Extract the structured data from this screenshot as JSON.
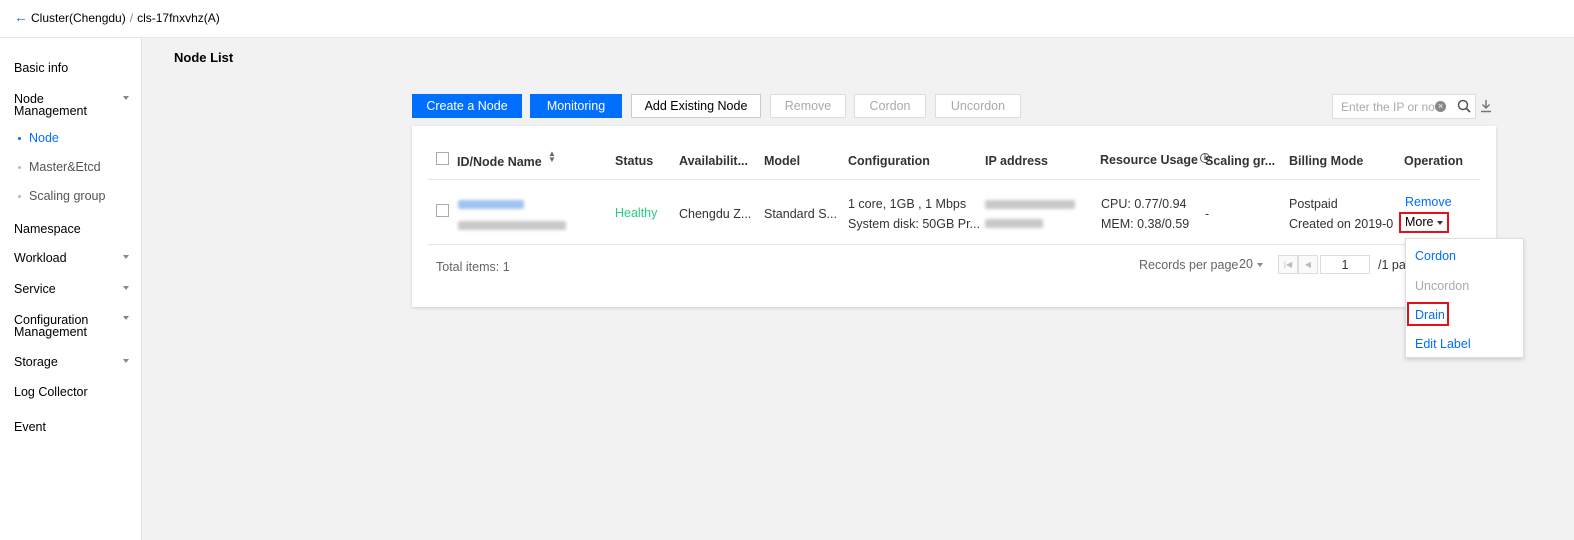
{
  "header": {
    "back_icon": "arrow-left-icon",
    "cluster": "Cluster(Chengdu)",
    "separator": "/",
    "cluster_id": "cls-17fnxvhz(A)"
  },
  "sidebar": {
    "basic_info": "Basic info",
    "node_mgmt_1": "Node",
    "node_mgmt_2": "Management",
    "node": "Node",
    "master": "Master&Etcd",
    "scaling": "Scaling group",
    "namespace": "Namespace",
    "workload": "Workload",
    "service": "Service",
    "config_1": "Configuration",
    "config_2": "Management",
    "storage": "Storage",
    "log": "Log Collector",
    "event": "Event"
  },
  "page": {
    "title": "Node List"
  },
  "toolbar": {
    "create": "Create a Node",
    "monitoring": "Monitoring",
    "add_existing": "Add Existing Node",
    "remove": "Remove",
    "cordon": "Cordon",
    "uncordon": "Uncordon",
    "search_placeholder": "Enter the IP or no",
    "accent": "#006eff"
  },
  "table": {
    "headers": {
      "id": "ID/Node Name",
      "status": "Status",
      "avail": "Availabilit...",
      "model": "Model",
      "config": "Configuration",
      "ip": "IP address",
      "usage": "Resource Usage",
      "scaling": "Scaling gr...",
      "billing": "Billing Mode",
      "operation": "Operation"
    },
    "rows": [
      {
        "status": "Healthy",
        "availability": "Chengdu Z...",
        "model": "Standard S...",
        "config_line1": "1 core, 1GB , 1 Mbps",
        "config_line2": "System disk: 50GB Pr...",
        "cpu": "CPU: 0.77/0.94",
        "mem": "MEM: 0.38/0.59",
        "scaling_group": "-",
        "billing": "Postpaid",
        "created": "Created on 2019-0",
        "op_remove": "Remove",
        "op_more": "More"
      }
    ]
  },
  "menu": {
    "cordon": "Cordon",
    "uncordon": "Uncordon",
    "drain": "Drain",
    "edit_label": "Edit Label"
  },
  "footer": {
    "total": "Total items:",
    "total_count": "1",
    "records_per_page": "Records per page",
    "page_size": "20",
    "page": "1",
    "page_of": "/1 pa"
  }
}
